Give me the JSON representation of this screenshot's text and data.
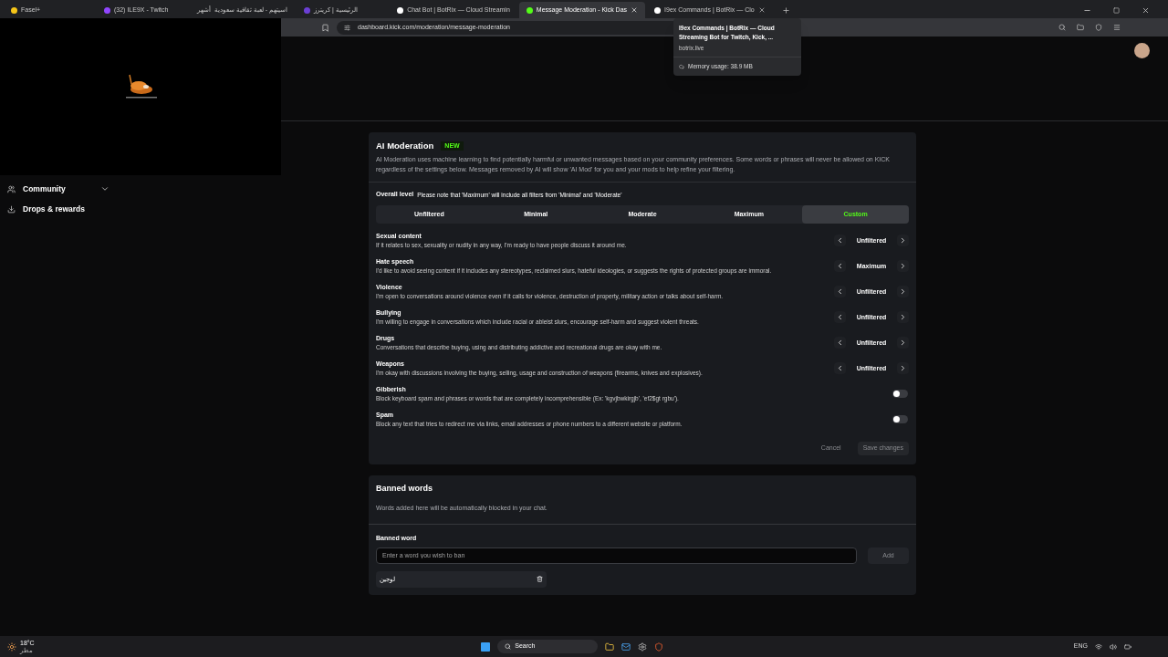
{
  "browser": {
    "tabs": [
      {
        "title": "Fasel+",
        "selected": false,
        "color": "#f5c518"
      },
      {
        "title": "(32) ILE9X - Twitch",
        "selected": false,
        "color": "#9146ff"
      },
      {
        "title": "اسيتهم - لعبة ثقافية سعودية",
        "selected": false,
        "icon_text": "أشهر"
      },
      {
        "title": "الرئيسية | كريترز",
        "selected": false,
        "color": "#6b3fd4"
      },
      {
        "title": "Chat Bot | BotRix — Cloud Streamin",
        "selected": false,
        "color": "#ffffff"
      },
      {
        "title": "Message Moderation - Kick Das",
        "selected": true,
        "color": "#53fc18"
      },
      {
        "title": "I9ex Commands | BotRix — Clo",
        "selected": false,
        "color": "#ffffff"
      }
    ],
    "url": "dashboard.kick.com/moderation/message-moderation",
    "tooltip": {
      "title": "I9ex Commands | BotRix — Cloud Streaming Bot for Twitch, Kick, ...",
      "domain": "botrix.live",
      "memory": "Memory usage: 38.9 MB"
    }
  },
  "sidebar": {
    "items": [
      {
        "label": "Community",
        "expandable": true
      },
      {
        "label": "Drops & rewards",
        "expandable": false
      }
    ]
  },
  "ai_moderation": {
    "title": "AI Moderation",
    "badge": "NEW",
    "description": "AI Moderation uses machine learning to find potentially harmful or unwanted messages based on your community preferences. Some words or phrases will never be allowed on KICK regardless of the settings below. Messages removed by AI will show 'AI Mod' for you and your mods to help refine your filtering.",
    "overall_label": "Overall level",
    "overall_note": "Please note that 'Maximum' will include all filters from 'Minimal' and 'Moderate'",
    "levels": [
      {
        "label": "Unfiltered",
        "selected": false
      },
      {
        "label": "Minimal",
        "selected": false
      },
      {
        "label": "Moderate",
        "selected": false
      },
      {
        "label": "Maximum",
        "selected": false
      },
      {
        "label": "Custom",
        "selected": true
      }
    ],
    "categories": [
      {
        "kind": "stepper",
        "name": "Sexual content",
        "description": "If it relates to sex, sexuality or nudity in any way, I'm ready to have people discuss it around me.",
        "value": "Unfiltered"
      },
      {
        "kind": "stepper",
        "name": "Hate speech",
        "description": "I'd like to avoid seeing content if it includes any stereotypes, reclaimed slurs, hateful ideologies, or suggests the rights of protected groups are immoral.",
        "value": "Maximum"
      },
      {
        "kind": "stepper",
        "name": "Violence",
        "description": "I'm open to conversations around violence even if it calls for violence, destruction of property, military action or talks about self-harm.",
        "value": "Unfiltered"
      },
      {
        "kind": "stepper",
        "name": "Bullying",
        "description": "I'm willing to engage in conversations which include racial or ableist slurs, encourage self-harm and suggest violent threats.",
        "value": "Unfiltered"
      },
      {
        "kind": "stepper",
        "name": "Drugs",
        "description": "Conversations that describe buying, using and distributing addictive and recreational drugs are okay with me.",
        "value": "Unfiltered"
      },
      {
        "kind": "stepper",
        "name": "Weapons",
        "description": "I'm okay with discussions involving the buying, selling, usage and construction of weapons (firearms, knives and explosives).",
        "value": "Unfiltered"
      },
      {
        "kind": "toggle",
        "name": "Gibberish",
        "description": "Block keyboard spam and phrases or words that are completely incomprehensible (Ex: 'kgvjbwkirgjb', 'ef2$gt rgbu').",
        "on": false
      },
      {
        "kind": "toggle",
        "name": "Spam",
        "description": "Block any text that tries to redirect me via links, email addresses or phone numbers to a different website or platform.",
        "on": false
      }
    ],
    "buttons": [
      {
        "label": "Cancel",
        "disabled": true
      },
      {
        "label": "Save changes",
        "disabled": true
      }
    ]
  },
  "banned_words": {
    "title": "Banned words",
    "description": "Words added here will be automatically blocked in your chat.",
    "field_label": "Banned word",
    "placeholder": "Enter a word you wish to ban",
    "add_button": "Add",
    "words": [
      "لوجين"
    ]
  },
  "taskbar": {
    "weather": "18°C",
    "weather_note": "مطر",
    "search": "Search",
    "language": "ENG"
  }
}
